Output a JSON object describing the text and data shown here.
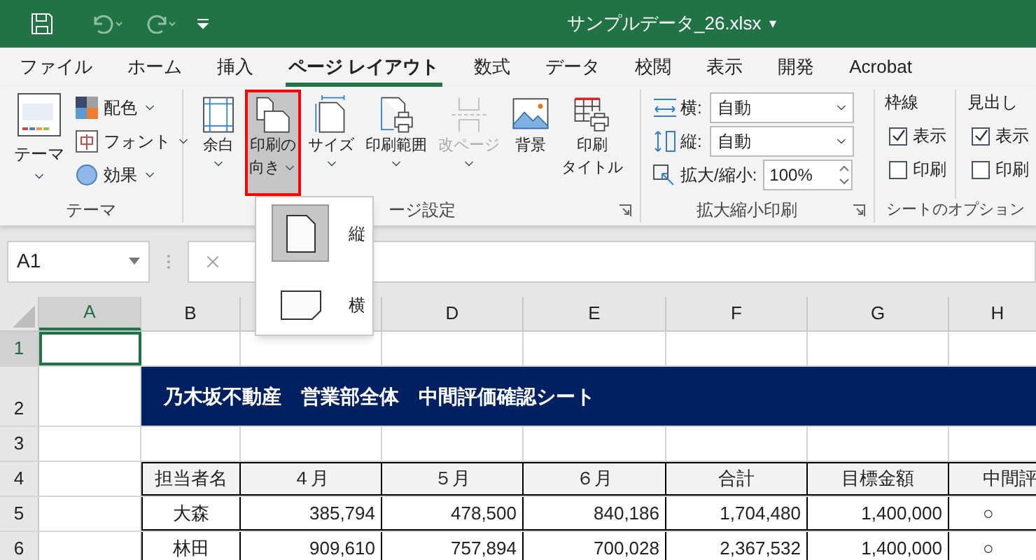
{
  "title_bar": {
    "file_name": "サンプルデータ_26.xlsx",
    "caret": "▾"
  },
  "tabs": [
    {
      "label": "ファイル",
      "selected": false
    },
    {
      "label": "ホーム",
      "selected": false
    },
    {
      "label": "挿入",
      "selected": false
    },
    {
      "label": "ページ レイアウト",
      "selected": true
    },
    {
      "label": "数式",
      "selected": false
    },
    {
      "label": "データ",
      "selected": false
    },
    {
      "label": "校閲",
      "selected": false
    },
    {
      "label": "表示",
      "selected": false
    },
    {
      "label": "開発",
      "selected": false
    },
    {
      "label": "Acrobat",
      "selected": false
    }
  ],
  "ribbon": {
    "theme_group": {
      "label": "テーマ",
      "theme_button": "テーマ",
      "items": [
        {
          "label": "配色",
          "kind": "colors"
        },
        {
          "label": "フォント",
          "kind": "fonts"
        },
        {
          "label": "効果",
          "kind": "effects"
        }
      ]
    },
    "page_setup": {
      "label": "ージ設定",
      "buttons": [
        {
          "lines": [
            "余白"
          ],
          "kind": "margins",
          "has_menu": true,
          "disabled": false,
          "highlighted": false
        },
        {
          "lines": [
            "印刷の",
            "向き"
          ],
          "kind": "orientation",
          "has_menu": true,
          "disabled": false,
          "highlighted": true
        },
        {
          "lines": [
            "サイズ"
          ],
          "kind": "size",
          "has_menu": true,
          "disabled": false,
          "highlighted": false
        },
        {
          "lines": [
            "印刷範囲"
          ],
          "kind": "print_area",
          "has_menu": true,
          "disabled": false,
          "highlighted": false
        },
        {
          "lines": [
            "改ページ"
          ],
          "kind": "breaks",
          "has_menu": true,
          "disabled": true,
          "highlighted": false
        },
        {
          "lines": [
            "背景"
          ],
          "kind": "background",
          "has_menu": false,
          "disabled": false,
          "highlighted": false
        },
        {
          "lines": [
            "印刷",
            "タイトル"
          ],
          "kind": "print_titles",
          "has_menu": false,
          "disabled": false,
          "highlighted": false
        }
      ]
    },
    "scale": {
      "label": "拡大縮小印刷",
      "fields": [
        {
          "label": "横:",
          "value": "自動",
          "kind": "width"
        },
        {
          "label": "縦:",
          "value": "自動",
          "kind": "height"
        },
        {
          "label": "拡大/縮小:",
          "value": "100%",
          "kind": "zoom"
        }
      ]
    },
    "sheet_options": {
      "label": "シートのオプション",
      "groups": [
        {
          "title": "枠線",
          "options": [
            {
              "label": "表示",
              "checked": true
            },
            {
              "label": "印刷",
              "checked": false
            }
          ]
        },
        {
          "title": "見出し",
          "options": [
            {
              "label": "表示",
              "checked": true
            },
            {
              "label": "印刷",
              "checked": false
            }
          ]
        }
      ]
    }
  },
  "orientation_menu": {
    "items": [
      {
        "label": "縦",
        "kind": "portrait",
        "selected": true
      },
      {
        "label": "横",
        "kind": "landscape",
        "selected": false
      }
    ]
  },
  "name_box": {
    "value": "A1"
  },
  "sheet": {
    "columns": [
      {
        "label": "A",
        "selected": true
      },
      {
        "label": "B",
        "selected": false
      },
      {
        "label": "D",
        "selected": false
      },
      {
        "label": "E",
        "selected": false
      },
      {
        "label": "F",
        "selected": false
      },
      {
        "label": "G",
        "selected": false
      },
      {
        "label": "H",
        "selected": false
      }
    ],
    "rows": [
      {
        "number": "1",
        "kind": "blank",
        "selected": true
      },
      {
        "number": "2",
        "kind": "title",
        "selected": false,
        "text": "乃木坂不動産　営業部全体　中間評価確認シート"
      },
      {
        "number": "3",
        "kind": "blank",
        "selected": false
      },
      {
        "number": "4",
        "kind": "header",
        "selected": false,
        "cells": [
          "担当者名",
          "４月",
          "５月",
          "６月",
          "合計",
          "目標金額",
          "中間評"
        ]
      },
      {
        "number": "5",
        "kind": "data",
        "selected": false,
        "cells": [
          "大森",
          "385,794",
          "478,500",
          "840,186",
          "1,704,480",
          "1,400,000",
          "○"
        ]
      },
      {
        "number": "6",
        "kind": "data",
        "selected": false,
        "cells": [
          "林田",
          "909,610",
          "757,894",
          "700,028",
          "2,367,532",
          "1,400,000",
          "○"
        ]
      }
    ]
  }
}
